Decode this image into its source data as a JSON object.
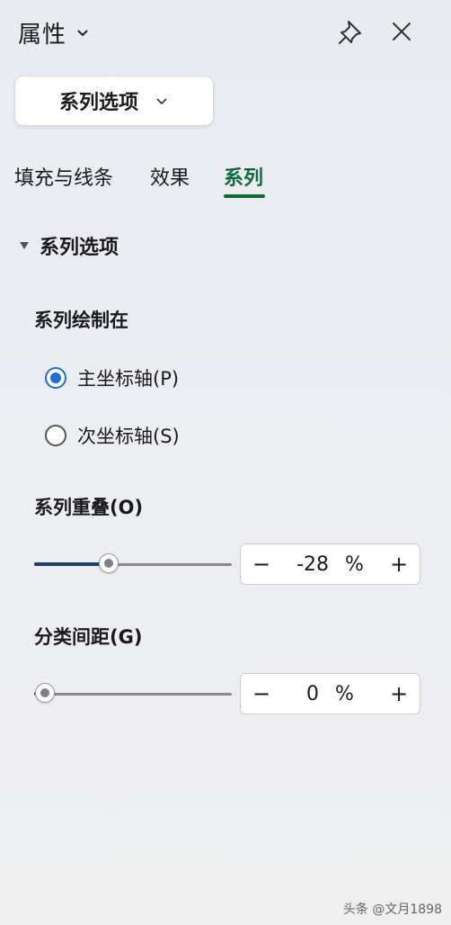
{
  "header": {
    "title": "属性",
    "title_chevron_icon": "chevron-down-icon",
    "pin_icon": "pin-icon",
    "close_icon": "close-icon"
  },
  "dropdown": {
    "label": "系列选项",
    "icon": "chevron-down-icon"
  },
  "tabs": [
    {
      "label": "填充与线条",
      "active": false
    },
    {
      "label": "效果",
      "active": false
    },
    {
      "label": "系列",
      "active": true
    }
  ],
  "section": {
    "title": "系列选项",
    "expanded": true,
    "plot_on": {
      "label": "系列绘制在",
      "options": [
        {
          "label": "主坐标轴(P)",
          "checked": true
        },
        {
          "label": "次坐标轴(S)",
          "checked": false
        }
      ]
    },
    "overlap": {
      "label": "系列重叠(O)",
      "value": "-28",
      "unit": "%",
      "minus": "−",
      "plus": "+",
      "slider_fraction": 0.36
    },
    "gap_width": {
      "label": "分类间距(G)",
      "value": "0",
      "unit": "%",
      "minus": "−",
      "plus": "+",
      "slider_fraction": 0.0
    }
  },
  "colors": {
    "accent_tab": "#0f6b3e",
    "radio": "#1d6fd6",
    "slider_fill": "#1c3f75"
  },
  "watermark": "头条 @文月1898"
}
